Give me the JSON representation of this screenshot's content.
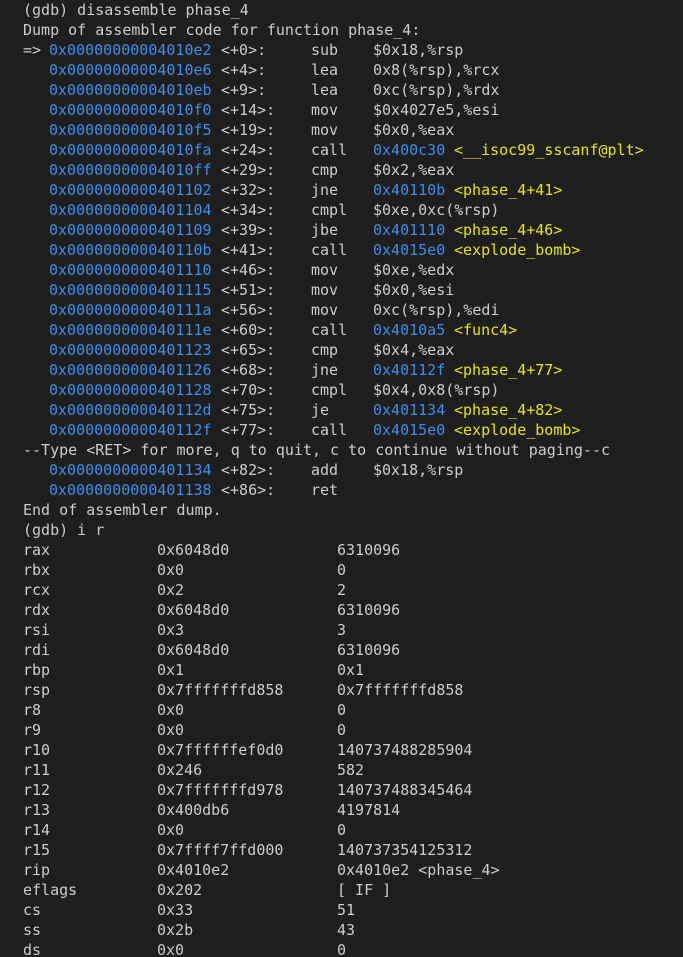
{
  "colors": {
    "background": "#1e1e1e",
    "foreground": "#cccccc",
    "address": "#3b8eea",
    "symbol": "#e5e510"
  },
  "header": [
    "(gdb) disassemble phase_4",
    "Dump of assembler code for function phase_4:"
  ],
  "current_marker": "=>",
  "asm_part1": [
    {
      "addr": "0x00000000004010e2",
      "offset": "<+0>:",
      "op": "sub",
      "args": "$0x18,%rsp"
    },
    {
      "addr": "0x00000000004010e6",
      "offset": "<+4>:",
      "op": "lea",
      "args": "0x8(%rsp),%rcx"
    },
    {
      "addr": "0x00000000004010eb",
      "offset": "<+9>:",
      "op": "lea",
      "args": "0xc(%rsp),%rdx"
    },
    {
      "addr": "0x00000000004010f0",
      "offset": "<+14>:",
      "op": "mov",
      "args": "$0x4027e5,%esi"
    },
    {
      "addr": "0x00000000004010f5",
      "offset": "<+19>:",
      "op": "mov",
      "args": "$0x0,%eax"
    },
    {
      "addr": "0x00000000004010fa",
      "offset": "<+24>:",
      "op": "call",
      "target": "0x400c30",
      "target_sym": "<__isoc99_sscanf@plt>"
    },
    {
      "addr": "0x00000000004010ff",
      "offset": "<+29>:",
      "op": "cmp",
      "args": "$0x2,%eax"
    },
    {
      "addr": "0x0000000000401102",
      "offset": "<+32>:",
      "op": "jne",
      "target": "0x40110b",
      "target_sym": "<phase_4+41>"
    },
    {
      "addr": "0x0000000000401104",
      "offset": "<+34>:",
      "op": "cmpl",
      "args": "$0xe,0xc(%rsp)"
    },
    {
      "addr": "0x0000000000401109",
      "offset": "<+39>:",
      "op": "jbe",
      "target": "0x401110",
      "target_sym": "<phase_4+46>"
    },
    {
      "addr": "0x000000000040110b",
      "offset": "<+41>:",
      "op": "call",
      "target": "0x4015e0",
      "target_sym": "<explode_bomb>"
    },
    {
      "addr": "0x0000000000401110",
      "offset": "<+46>:",
      "op": "mov",
      "args": "$0xe,%edx"
    },
    {
      "addr": "0x0000000000401115",
      "offset": "<+51>:",
      "op": "mov",
      "args": "$0x0,%esi"
    },
    {
      "addr": "0x000000000040111a",
      "offset": "<+56>:",
      "op": "mov",
      "args": "0xc(%rsp),%edi"
    },
    {
      "addr": "0x000000000040111e",
      "offset": "<+60>:",
      "op": "call",
      "target": "0x4010a5",
      "target_sym": "<func4>"
    },
    {
      "addr": "0x0000000000401123",
      "offset": "<+65>:",
      "op": "cmp",
      "args": "$0x4,%eax"
    },
    {
      "addr": "0x0000000000401126",
      "offset": "<+68>:",
      "op": "jne",
      "target": "0x40112f",
      "target_sym": "<phase_4+77>"
    },
    {
      "addr": "0x0000000000401128",
      "offset": "<+70>:",
      "op": "cmpl",
      "args": "$0x4,0x8(%rsp)"
    },
    {
      "addr": "0x000000000040112d",
      "offset": "<+75>:",
      "op": "je",
      "target": "0x401134",
      "target_sym": "<phase_4+82>"
    },
    {
      "addr": "0x000000000040112f",
      "offset": "<+77>:",
      "op": "call",
      "target": "0x4015e0",
      "target_sym": "<explode_bomb>"
    }
  ],
  "pager_prompt": "--Type <RET> for more, q to quit, c to continue without paging--c",
  "asm_part2": [
    {
      "addr": "0x0000000000401134",
      "offset": "<+82>:",
      "op": "add",
      "args": "$0x18,%rsp"
    },
    {
      "addr": "0x0000000000401138",
      "offset": "<+86>:",
      "op": "ret",
      "args": ""
    }
  ],
  "dump_end": "End of assembler dump.",
  "regs_command": "(gdb) i r",
  "registers": [
    {
      "name": "rax",
      "hex": "0x6048d0",
      "value": "6310096"
    },
    {
      "name": "rbx",
      "hex": "0x0",
      "value": "0"
    },
    {
      "name": "rcx",
      "hex": "0x2",
      "value": "2"
    },
    {
      "name": "rdx",
      "hex": "0x6048d0",
      "value": "6310096"
    },
    {
      "name": "rsi",
      "hex": "0x3",
      "value": "3"
    },
    {
      "name": "rdi",
      "hex": "0x6048d0",
      "value": "6310096"
    },
    {
      "name": "rbp",
      "hex": "0x1",
      "value": "0x1"
    },
    {
      "name": "rsp",
      "hex": "0x7fffffffd858",
      "value": "0x7fffffffd858"
    },
    {
      "name": "r8",
      "hex": "0x0",
      "value": "0"
    },
    {
      "name": "r9",
      "hex": "0x0",
      "value": "0"
    },
    {
      "name": "r10",
      "hex": "0x7ffffffef0d0",
      "value": "140737488285904"
    },
    {
      "name": "r11",
      "hex": "0x246",
      "value": "582"
    },
    {
      "name": "r12",
      "hex": "0x7fffffffd978",
      "value": "140737488345464"
    },
    {
      "name": "r13",
      "hex": "0x400db6",
      "value": "4197814"
    },
    {
      "name": "r14",
      "hex": "0x0",
      "value": "0"
    },
    {
      "name": "r15",
      "hex": "0x7ffff7ffd000",
      "value": "140737354125312"
    },
    {
      "name": "rip",
      "hex": "0x4010e2",
      "value": "0x4010e2 <phase_4>"
    },
    {
      "name": "eflags",
      "hex": "0x202",
      "value": "[ IF ]"
    },
    {
      "name": "cs",
      "hex": "0x33",
      "value": "51"
    },
    {
      "name": "ss",
      "hex": "0x2b",
      "value": "43"
    },
    {
      "name": "ds",
      "hex": "0x0",
      "value": "0"
    }
  ]
}
